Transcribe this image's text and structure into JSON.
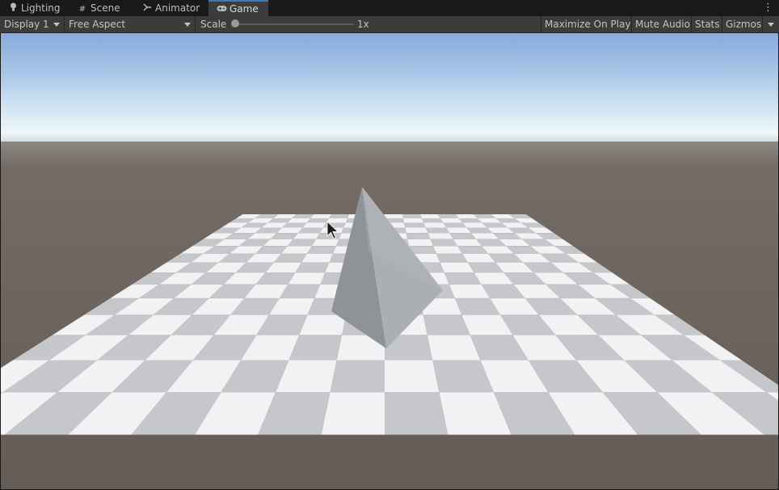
{
  "tabs": [
    {
      "label": "Lighting",
      "icon": "lightbulb-icon",
      "active": false
    },
    {
      "label": "Scene",
      "icon": "grid-icon",
      "active": false
    },
    {
      "label": "Animator",
      "icon": "animator-icon",
      "active": false
    },
    {
      "label": "Game",
      "icon": "gamepad-icon",
      "active": true
    }
  ],
  "toolbar": {
    "display": "Display 1",
    "aspect": "Free Aspect",
    "scale_label": "Scale",
    "scale_value": "1x",
    "maximize_on_play": "Maximize On Play",
    "mute_audio": "Mute Audio",
    "stats": "Stats",
    "gizmos": "Gizmos"
  },
  "scene": {
    "objects": [
      "plane",
      "pyramid"
    ],
    "colors": {
      "sky_top": "#8aaedb",
      "horizon": "#e8f3f8",
      "ground": "#6b615a",
      "tile_light": "#f2f2f4",
      "tile_dark": "#c6c7ca",
      "pyramid_left": "#8e9296",
      "pyramid_right": "#a9acb0",
      "tab_accent": "#3a79bb"
    }
  }
}
